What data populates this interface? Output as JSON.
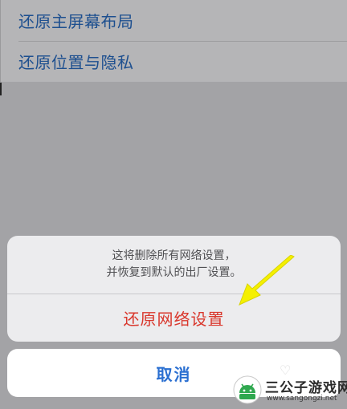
{
  "settings_list": {
    "items": [
      {
        "label": "还原主屏幕布局"
      },
      {
        "label": "还原位置与隐私"
      }
    ]
  },
  "action_sheet": {
    "message_line1": "这将删除所有网络设置，",
    "message_line2": "并恢复到默认的出厂设置。",
    "destructive_label": "还原网络设置",
    "cancel_label": "取消"
  },
  "watermark": {
    "title": "三公子游戏网",
    "url": "www.sangongzi.net"
  },
  "colors": {
    "overlay": "#a3a3a6",
    "link_blue": "#1d4f8f",
    "destructive_red": "#d9372c",
    "cancel_blue": "#2a6fd1",
    "arrow_yellow": "#f5f000"
  },
  "icons": {
    "arrow": "yellow-pointer-arrow-icon",
    "logo": "android-logo-icon"
  }
}
